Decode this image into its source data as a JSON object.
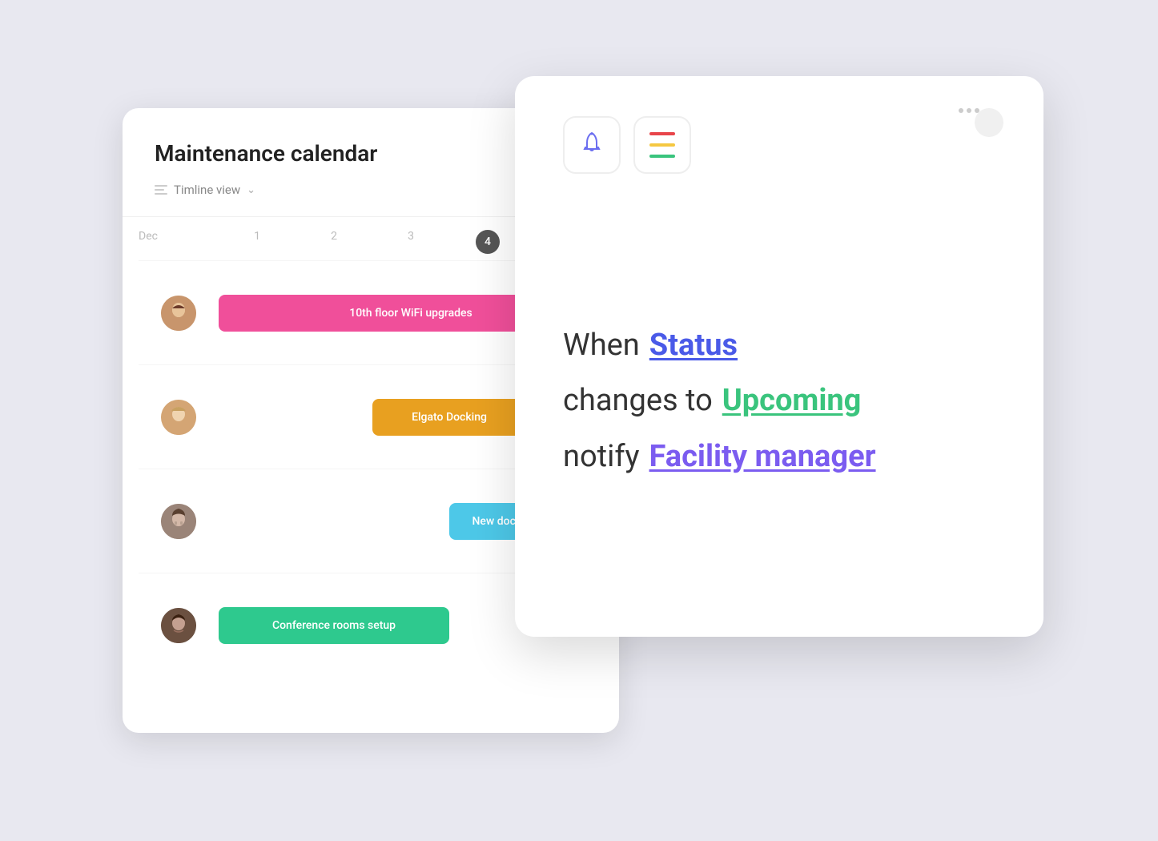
{
  "calendar": {
    "title": "Maintenance calendar",
    "toolbar": {
      "label": "Timline view",
      "arrow": "⌄"
    },
    "header": {
      "month": "Dec",
      "days": [
        "1",
        "2",
        "3",
        "4"
      ]
    },
    "rows": [
      {
        "id": "row-1",
        "avatar_type": "female1",
        "task": {
          "label": "10th floor WiFi upgrades",
          "color": "pink",
          "span_start": 1,
          "span_end": 6
        }
      },
      {
        "id": "row-2",
        "avatar_type": "female2",
        "task": {
          "label": "Elgato Docking",
          "color": "yellow",
          "span_start": 3,
          "span_end": 5
        }
      },
      {
        "id": "row-3",
        "avatar_type": "male1",
        "task": {
          "label": "New docking stations",
          "color": "cyan",
          "span_start": 4,
          "span_end": 7
        }
      },
      {
        "id": "row-4",
        "avatar_type": "male2",
        "task": {
          "label": "Conference rooms setup",
          "color": "green",
          "span_start": 1,
          "span_end": 4
        }
      }
    ]
  },
  "notification": {
    "icons": {
      "bell": "🔔",
      "lines_label": "priority lines"
    },
    "lines": [
      {
        "prefix": "When",
        "keyword": "Status",
        "keyword_class": "keyword-blue"
      },
      {
        "prefix": "changes to",
        "keyword": "Upcoming",
        "keyword_class": "keyword-green"
      },
      {
        "prefix": "notify",
        "keyword": "Facility manager",
        "keyword_class": "keyword-purple"
      }
    ]
  },
  "dots": [
    "•",
    "•",
    "•"
  ]
}
